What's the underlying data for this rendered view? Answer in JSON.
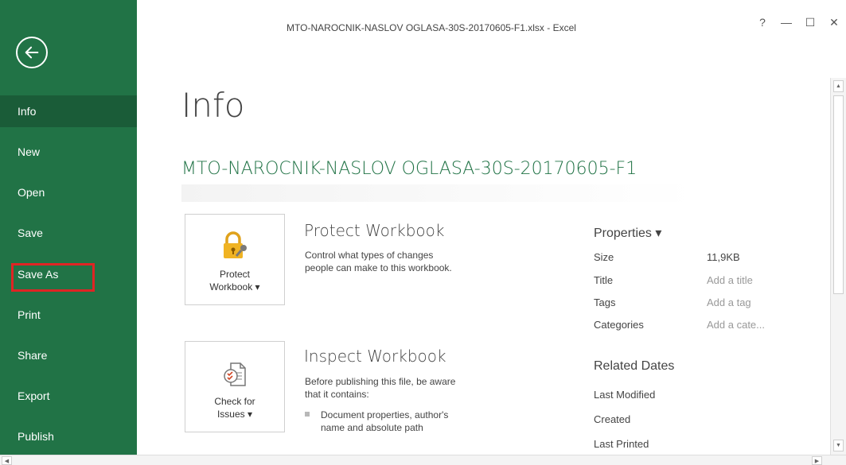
{
  "window": {
    "title": "MTO-NAROCNIK-NASLOV OGLASA-30S-20170605-F1.xlsx - Excel",
    "help": "?",
    "minimize": "—",
    "maximize": "☐",
    "close": "✕"
  },
  "sidebar": {
    "back_icon": "back-arrow-icon",
    "items": [
      {
        "label": "Info",
        "active": true
      },
      {
        "label": "New"
      },
      {
        "label": "Open"
      },
      {
        "label": "Save"
      },
      {
        "label": "Save As",
        "highlighted": true
      },
      {
        "label": "Print"
      },
      {
        "label": "Share"
      },
      {
        "label": "Export"
      },
      {
        "label": "Publish"
      }
    ]
  },
  "main": {
    "page_title": "Info",
    "file_name": "MTO-NAROCNIK-NASLOV OGLASA-30S-20170605-F1",
    "protect": {
      "button_line1": "Protect",
      "button_line2": "Workbook ▾",
      "title": "Protect Workbook",
      "desc_line1": "Control what types of changes",
      "desc_line2": "people can make to this workbook."
    },
    "inspect": {
      "button_line1": "Check for",
      "button_line2": "Issues ▾",
      "title": "Inspect Workbook",
      "desc_line1": "Before publishing this file, be aware",
      "desc_line2": "that it contains:",
      "bullet_line1": "Document properties, author's",
      "bullet_line2": "name and absolute path"
    }
  },
  "properties": {
    "title": "Properties ▾",
    "rows": [
      {
        "label": "Size",
        "value": "11,9KB"
      },
      {
        "label": "Title",
        "value": "Add a title"
      },
      {
        "label": "Tags",
        "value": "Add a tag"
      },
      {
        "label": "Categories",
        "value": "Add a cate..."
      }
    ],
    "related_title": "Related Dates",
    "dates": [
      {
        "label": "Last Modified"
      },
      {
        "label": "Created"
      },
      {
        "label": "Last Printed"
      }
    ]
  },
  "colors": {
    "accent": "#217346",
    "highlight_box": "#e02424"
  }
}
